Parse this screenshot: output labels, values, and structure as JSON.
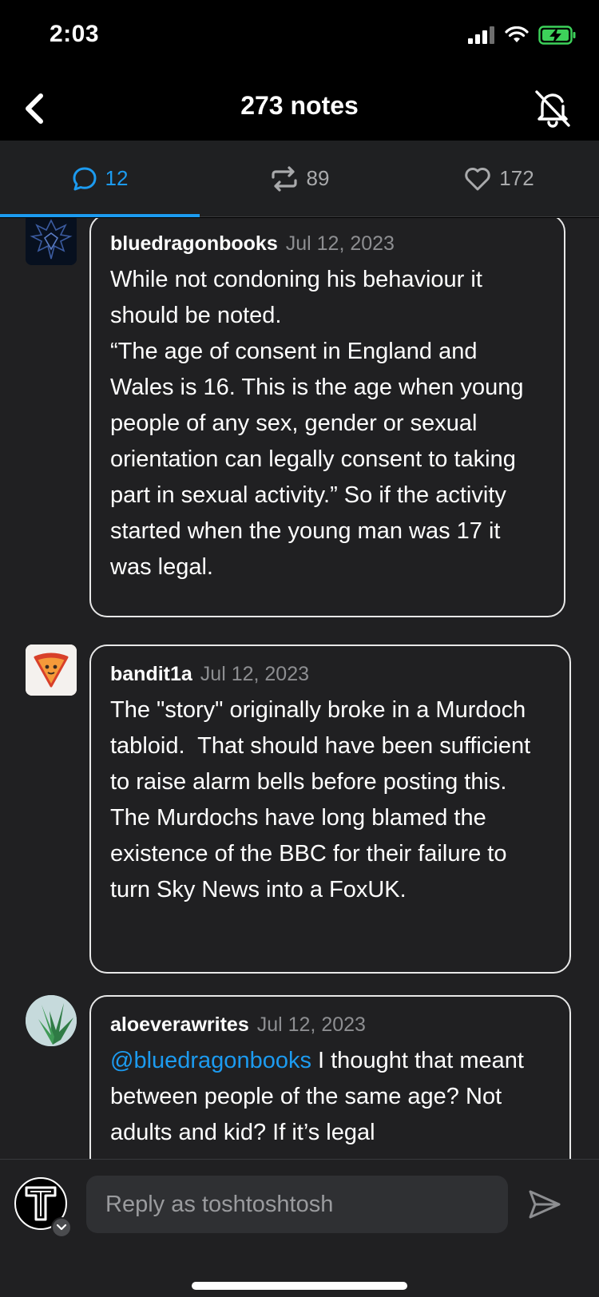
{
  "status_bar": {
    "time": "2:03"
  },
  "header": {
    "title": "273 notes"
  },
  "tabs": [
    {
      "label": "12",
      "icon": "comment-icon",
      "active": true
    },
    {
      "label": "89",
      "icon": "reblog-icon",
      "active": false
    },
    {
      "label": "172",
      "icon": "heart-icon",
      "active": false
    }
  ],
  "notes": [
    {
      "username": "bluedragonbooks",
      "date": "Jul 12, 2023",
      "text": "While not condoning his behaviour it should be noted.\n“The age of consent in England and Wales is 16. This is the age when young people of any sex, gender or sexual orientation can legally consent to taking part in sexual activity.” So if the activity started when the young man was 17 it was legal."
    },
    {
      "username": "bandit1a",
      "date": "Jul 12, 2023",
      "text": "The \"story\" originally broke in a Murdoch tabloid.  That should have been sufficient to raise alarm bells before posting this.  The Murdochs have long blamed the existence of the BBC for their failure to turn Sky News into a FoxUK."
    },
    {
      "username": "aloeverawrites",
      "date": "Jul 12, 2023",
      "mention": "@bluedragonbooks",
      "text": " I thought that meant between people of the same age? Not adults and kid? If it’s legal"
    }
  ],
  "reply": {
    "placeholder": "Reply as toshtoshtosh"
  },
  "colors": {
    "accent": "#1c9bf0",
    "background": "#202022",
    "bar": "#000000"
  }
}
